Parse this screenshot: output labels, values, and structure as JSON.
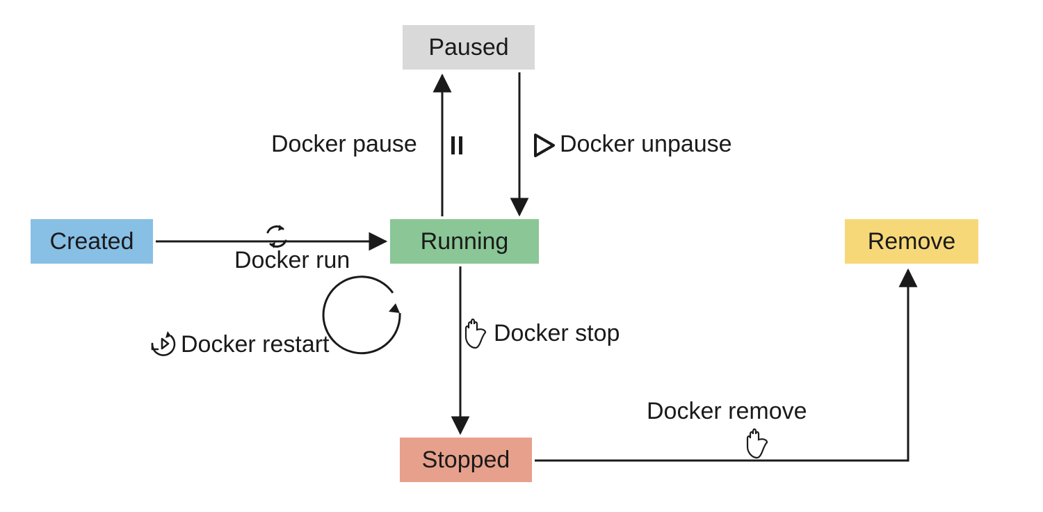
{
  "states": {
    "created": "Created",
    "running": "Running",
    "paused": "Paused",
    "stopped": "Stopped",
    "remove": "Remove"
  },
  "transitions": {
    "run": "Docker run",
    "pause": "Docker pause",
    "unpause": "Docker unpause",
    "stop": "Docker stop",
    "restart": "Docker restart",
    "remove": "Docker remove"
  },
  "diagram": {
    "type": "state-machine",
    "nodes": [
      "Created",
      "Running",
      "Paused",
      "Stopped",
      "Remove"
    ],
    "edges": [
      {
        "from": "Created",
        "to": "Running",
        "label": "Docker run"
      },
      {
        "from": "Running",
        "to": "Paused",
        "label": "Docker pause"
      },
      {
        "from": "Paused",
        "to": "Running",
        "label": "Docker unpause"
      },
      {
        "from": "Running",
        "to": "Stopped",
        "label": "Docker stop"
      },
      {
        "from": "Running",
        "to": "Running",
        "label": "Docker restart"
      },
      {
        "from": "Stopped",
        "to": "Remove",
        "label": "Docker remove"
      }
    ]
  }
}
